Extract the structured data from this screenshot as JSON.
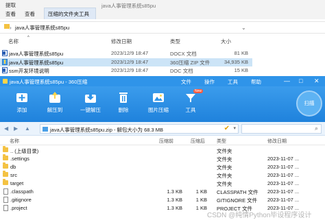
{
  "explorer": {
    "window_title": "java人事管理系统s85pu",
    "tabs": [
      "查看",
      "查看"
    ],
    "tab_top_left": "提取",
    "active_tab": "压缩的文件夹工具",
    "address": {
      "parent_chevron": "›",
      "folder": "java人事管理系统s85pu",
      "dropdown": "⌄"
    },
    "columns": [
      "名称",
      "修改日期",
      "类型",
      "大小"
    ],
    "sort_arrow": "^",
    "files": [
      {
        "name": "java人事管理系统s85pu",
        "date": "2023/12/9 18:47",
        "type": "DOCX 文档",
        "size": "81 KB",
        "icon": "word-doc-icon"
      },
      {
        "name": "java人事管理系统s85pu",
        "date": "2023/12/9 18:47",
        "type": "360压缩 ZIP 文件",
        "size": "34,935 KB",
        "icon": "zip-archive-icon",
        "selected": true
      },
      {
        "name": "ssm开发环境说明",
        "date": "2023/12/9 18:47",
        "type": "DOC 文档",
        "size": "15 KB",
        "icon": "word-doc-icon"
      }
    ]
  },
  "zip": {
    "title": "java人事管理系统s85pu - 360压缩",
    "menu": [
      "文件",
      "操作",
      "工具",
      "帮助"
    ],
    "window_controls": [
      "—",
      "□",
      "✕"
    ],
    "toolbar": [
      {
        "label": "添加",
        "icon": "add-icon"
      },
      {
        "label": "解压到",
        "icon": "extract-to-icon"
      },
      {
        "label": "一键解压",
        "icon": "one-click-extract-icon"
      },
      {
        "label": "删除",
        "icon": "delete-icon"
      },
      {
        "label": "图片压缩",
        "icon": "image-compress-icon"
      },
      {
        "label": "工具",
        "icon": "tools-icon"
      }
    ],
    "new_badge": "New",
    "scan_label": "扫描",
    "path_text": "java人事管理系统s85pu.zip - 解包大小为 68.3 MB",
    "columns": [
      "名称",
      "压缩前",
      "压缩后",
      "类型",
      "修改日期"
    ],
    "rows": [
      {
        "name": ".. (上级目录)",
        "before": "",
        "after": "",
        "type": "文件夹",
        "date": "",
        "kind": "folder"
      },
      {
        "name": ".settings",
        "before": "",
        "after": "",
        "type": "文件夹",
        "date": "2023-11-07 ...",
        "kind": "folder"
      },
      {
        "name": "db",
        "before": "",
        "after": "",
        "type": "文件夹",
        "date": "2023-11-07 ...",
        "kind": "folder"
      },
      {
        "name": "src",
        "before": "",
        "after": "",
        "type": "文件夹",
        "date": "2023-11-07 ...",
        "kind": "folder"
      },
      {
        "name": "target",
        "before": "",
        "after": "",
        "type": "文件夹",
        "date": "2023-11-07 ...",
        "kind": "folder"
      },
      {
        "name": ".classpath",
        "before": "1.3 KB",
        "after": "1 KB",
        "type": "CLASSPATH 文件",
        "date": "2023-11-07 ...",
        "kind": "file"
      },
      {
        "name": ".gitignore",
        "before": "1.3 KB",
        "after": "1 KB",
        "type": "GITIGNORE 文件",
        "date": "2023-11-07 ...",
        "kind": "file"
      },
      {
        "name": ".project",
        "before": "1.3 KB",
        "after": "1 KB",
        "type": "PROJECT 文件",
        "date": "2023-11-07 ...",
        "kind": "file"
      }
    ]
  },
  "watermark": "CSDN @纯情Python毕设程序设计",
  "colors": {
    "accent": "#2f94e9",
    "selection": "#cce4f7",
    "folder": "#f4c242"
  }
}
